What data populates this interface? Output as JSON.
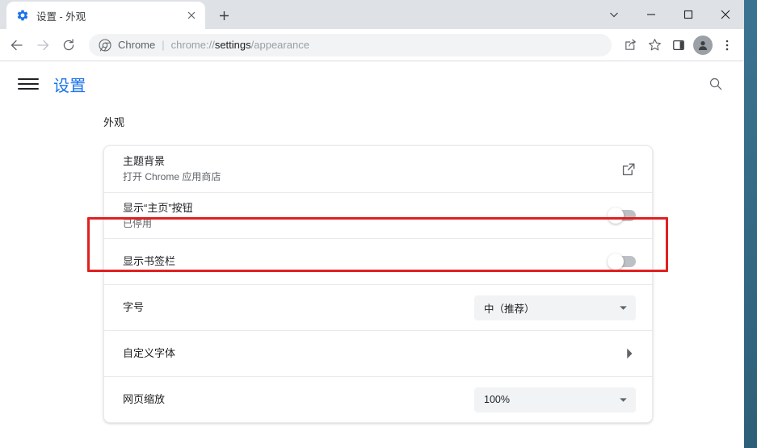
{
  "window": {
    "controls": {
      "tab_search": "tab-search-chevron",
      "minimize": "minimize",
      "maximize": "maximize",
      "close": "close"
    }
  },
  "tabstrip": {
    "tabs": [
      {
        "title": "设置 - 外观",
        "favicon": "gear-icon",
        "close_label": "×"
      }
    ],
    "new_tab_label": "+"
  },
  "toolbar": {
    "back_label": "←",
    "forward_label": "→",
    "reload_label": "⟳",
    "omnibox": {
      "chip": "Chrome",
      "separator": "|",
      "url_prefix": "chrome://",
      "url_bold": "settings",
      "url_suffix": "/appearance",
      "full_url": "chrome://settings/appearance"
    },
    "share_icon": "share-icon",
    "bookmark_icon": "star-icon",
    "side_panel_icon": "side-panel-icon",
    "profile_icon": "profile-avatar-icon",
    "menu_icon": "three-dot-menu-icon"
  },
  "settings": {
    "menu_icon": "hamburger-icon",
    "title": "设置",
    "search_icon": "search-icon",
    "section_title": "外观",
    "rows": [
      {
        "label": "主题背景",
        "sub": "打开 Chrome 应用商店",
        "action": "external-link",
        "highlighted": true
      },
      {
        "label": "显示“主页”按钮",
        "sub": "已停用",
        "action": "toggle",
        "toggle_on": false
      },
      {
        "label": "显示书签栏",
        "sub": "",
        "action": "toggle",
        "toggle_on": false
      },
      {
        "label": "字号",
        "sub": "",
        "action": "select",
        "value": "中（推荐）"
      },
      {
        "label": "自定义字体",
        "sub": "",
        "action": "subpage"
      },
      {
        "label": "网页缩放",
        "sub": "",
        "action": "select",
        "value": "100%"
      }
    ]
  },
  "colors": {
    "accent": "#1a73e8",
    "highlight": "#e02020",
    "tabstrip_bg": "#dee1e6",
    "desktop_bg": "#3a7390",
    "toggle_off": "#bdc1c6",
    "select_bg": "#f1f3f4"
  }
}
